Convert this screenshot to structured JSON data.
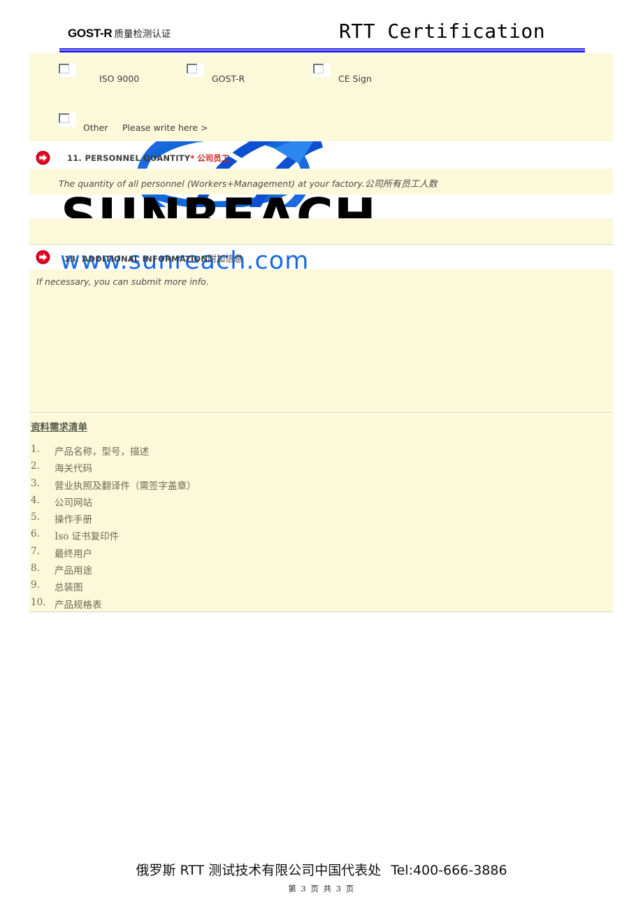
{
  "header": {
    "brand_en": "GOST-R",
    "brand_cn": "质量检测认证",
    "title_right": "RTT Certification",
    "rule_color": "#1c18e8"
  },
  "watermark": {
    "wordmark": "SUNREACH",
    "url": "www.sunreach.com",
    "globe_color": "#1b6ae0",
    "wordmark_color": "#000000",
    "url_color": "#1b6ae0"
  },
  "certifications": {
    "options": [
      {
        "label": "ISO 9000",
        "checked": false
      },
      {
        "label": "GOST-R",
        "checked": false
      },
      {
        "label": "CE Sign",
        "checked": false
      }
    ],
    "other": {
      "label": "Other",
      "checked": false
    },
    "other_hint": "Please write here >"
  },
  "sections": [
    {
      "number": "11.",
      "title_en": "PERSONNEL QUANTITY",
      "required_mark": "*",
      "title_cn": "公司员工",
      "cn_color": "#d21f1f",
      "hint_en": "The quantity of all personnel (Workers+Management) at your factory.",
      "hint_cn": "公司所有员工人数",
      "answer": ""
    },
    {
      "number": "13.",
      "title_en": "ADDITIONAL INFORMATION",
      "required_mark": "",
      "title_cn": "附加信息",
      "cn_color": "#3d3d3d",
      "hint_en": "If necessary, you can submit more info.",
      "hint_cn": "",
      "answer": ""
    }
  ],
  "requirements": {
    "title": "资料需求清单",
    "items": [
      {
        "num": "1.",
        "text": "产品名称，型号，描述"
      },
      {
        "num": "2.",
        "text": "海关代码"
      },
      {
        "num": "3.",
        "text": "营业执照及翻译件（需签字盖章）"
      },
      {
        "num": "4.",
        "text": "公司网站"
      },
      {
        "num": "5.",
        "text": "操作手册"
      },
      {
        "num": "6.",
        "text": "Iso 证书复印件"
      },
      {
        "num": "7.",
        "text": "最终用户"
      },
      {
        "num": "8.",
        "text": "产品用途"
      },
      {
        "num": "9.",
        "text": "总装图"
      },
      {
        "num": "10.",
        "text": "产品规格表"
      }
    ]
  },
  "footer": {
    "company": "俄罗斯 RTT 测试技术有限公司中国代表处",
    "tel": "Tel:400-666-3886",
    "page_info": "第 3 页 共 3 页"
  }
}
